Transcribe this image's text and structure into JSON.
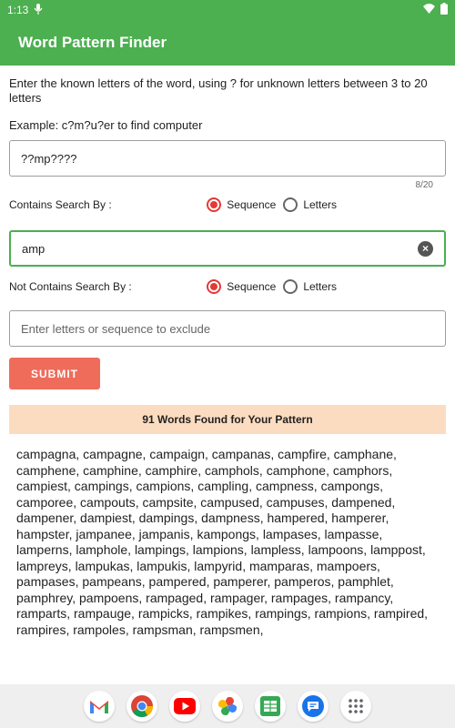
{
  "status_bar": {
    "time": "1:13"
  },
  "app_bar": {
    "title": "Word Pattern Finder"
  },
  "instructions": "Enter the known letters of the word, using ? for unknown letters between 3 to 20 letters",
  "example": "Example: c?m?u?er to find computer",
  "pattern_input": {
    "value": "??mp????",
    "counter": "8/20"
  },
  "contains": {
    "label": "Contains Search By :",
    "options": [
      {
        "label": "Sequence",
        "selected": true
      },
      {
        "label": "Letters",
        "selected": false
      }
    ],
    "input_value": "amp"
  },
  "not_contains": {
    "label": "Not Contains Search By :",
    "options": [
      {
        "label": "Sequence",
        "selected": true
      },
      {
        "label": "Letters",
        "selected": false
      }
    ],
    "placeholder": "Enter letters or sequence to exclude"
  },
  "submit_label": "SUBMIT",
  "result_banner": "91 Words Found for Your Pattern",
  "results_text": "campagna, campagne, campaign, campanas, campfire, camphane, camphene, camphine, camphire, camphols, camphone, camphors, campiest, campings, campions, campling, campness, campongs, camporee, campouts, campsite, campused, campuses, dampened, dampener, dampiest, dampings, dampness, hampered, hamperer, hampster, jampanee, jampanis, kampongs, lampases, lampasse, lamperns, lamphole, lampings, lampions, lampless, lampoons, lamppost, lampreys, lampukas, lampukis, lampyrid, mamparas, mampoers, pampases, pampeans, pampered, pamperer, pamperos, pamphlet, pamphrey, pampoens, rampaged, rampager, rampages, rampancy, ramparts, rampauge, rampicks, rampikes, rampings, rampions, rampired, rampires, rampoles, rampsman, rampsmen,",
  "dock_apps": [
    "gmail-icon",
    "chrome-icon",
    "youtube-icon",
    "photos-icon",
    "sheets-icon",
    "messages-icon",
    "app-drawer-icon"
  ],
  "colors": {
    "primary": "#4caf50",
    "accent": "#e53935",
    "submit": "#ef6c5b",
    "banner": "#fcdcc0"
  }
}
